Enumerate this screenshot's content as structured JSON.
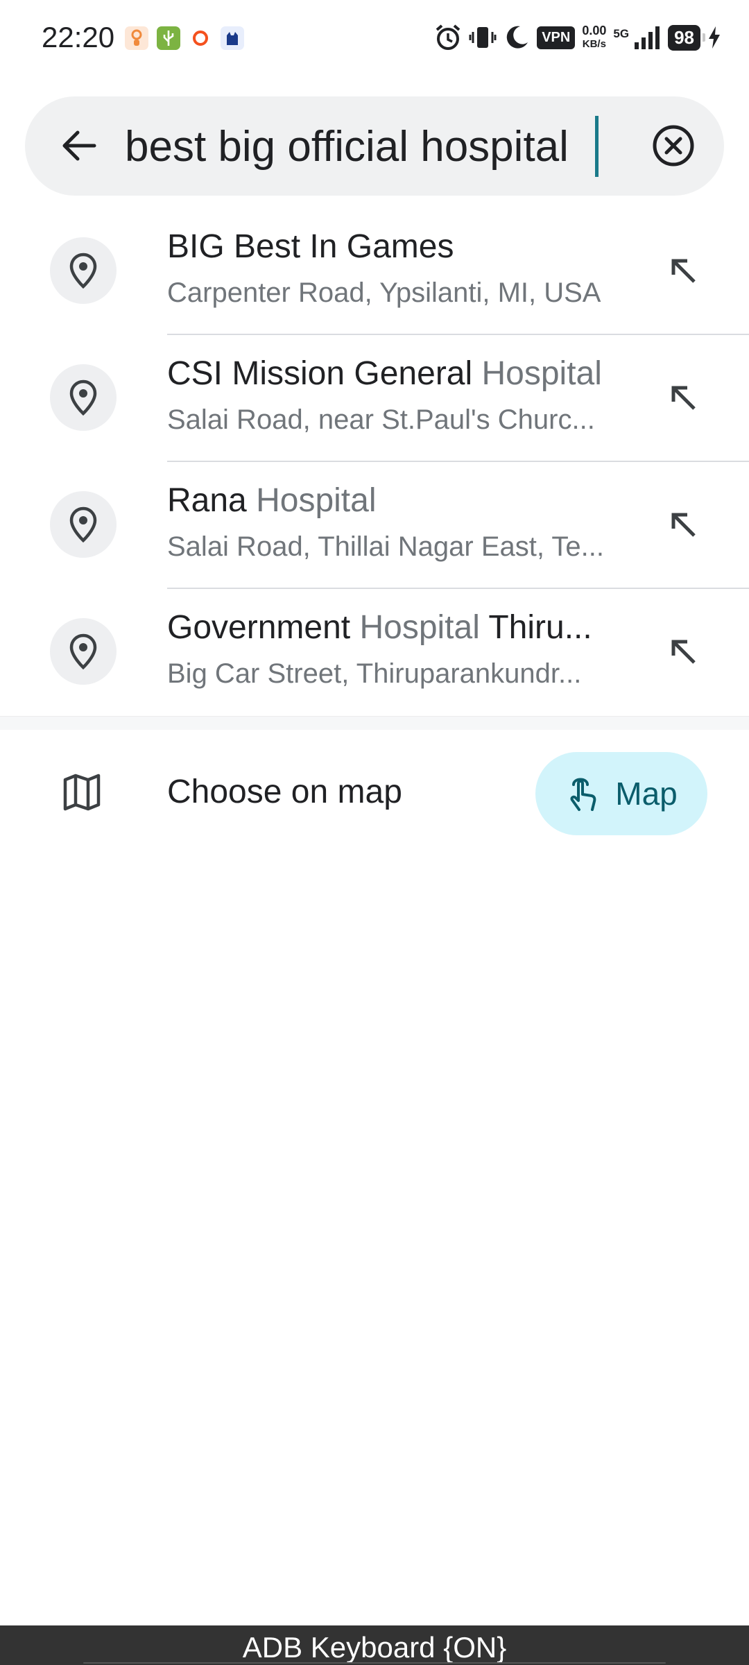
{
  "status_bar": {
    "time": "22:20",
    "notification_icons": [
      "notification-app-icon",
      "usb-icon",
      "record-icon",
      "cat-app-icon"
    ],
    "vpn": "VPN",
    "speed_value": "0.00",
    "speed_unit": "KB/s",
    "network": "5G",
    "battery": "98"
  },
  "search": {
    "query": "best big official hospital",
    "back_icon": "arrow-back-icon",
    "clear_icon": "clear-circle-icon"
  },
  "results": [
    {
      "title_main": "BIG Best In Games",
      "title_highlight": "",
      "title_tail": "",
      "subtitle": "Carpenter Road, Ypsilanti, MI, USA"
    },
    {
      "title_main": "CSI Mission General",
      "title_highlight": " Hospital",
      "title_tail": "",
      "subtitle": "Salai Road, near St.Paul's Churc..."
    },
    {
      "title_main": "Rana",
      "title_highlight": " Hospital",
      "title_tail": "",
      "subtitle": "Salai Road, Thillai Nagar East, Te..."
    },
    {
      "title_main": "Government",
      "title_highlight": " Hospital",
      "title_tail": " Thiru...",
      "subtitle": "Big Car Street, Thiruparankundr..."
    }
  ],
  "choose_on_map": {
    "label": "Choose on map",
    "map_button": "Map"
  },
  "bottom_bar": {
    "label": "ADB Keyboard {ON}"
  },
  "colors": {
    "accent": "#0b5d6b",
    "map_button_bg": "#d2f4fb",
    "search_bg": "#f0f1f2"
  }
}
